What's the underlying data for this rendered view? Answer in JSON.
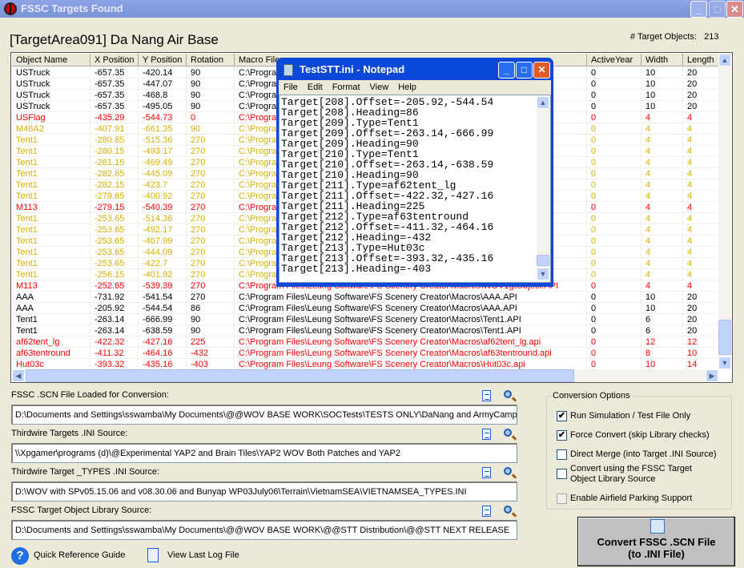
{
  "window": {
    "title": "FSSC Targets Found",
    "min": "_",
    "max": "□",
    "close": "✕"
  },
  "header": {
    "title": "[TargetArea091]   Da Nang Air Base",
    "count_label": "# Target Objects:",
    "count": "213"
  },
  "colors": {
    "normal": "#000000",
    "red": "#ff0000",
    "yellow": "#d4b000",
    "titlebar": "#7b91d8",
    "notepad_frame": "#0a48d8"
  },
  "table": {
    "columns": [
      "Object Name",
      "X Position",
      "Y Position",
      "Rotation",
      "Macro File",
      "ActiveYear",
      "Width",
      "Length"
    ],
    "rows": [
      {
        "c": "normal",
        "v": [
          "USTruck",
          "-657.35",
          "-420.14",
          "90",
          "C:\\Progra",
          "0",
          "10",
          "20"
        ]
      },
      {
        "c": "normal",
        "v": [
          "USTruck",
          "-657.35",
          "-447.07",
          "90",
          "C:\\Progra",
          "0",
          "10",
          "20"
        ]
      },
      {
        "c": "normal",
        "v": [
          "USTruck",
          "-657.35",
          "-468.8",
          "90",
          "C:\\Progra",
          "0",
          "10",
          "20"
        ]
      },
      {
        "c": "normal",
        "v": [
          "USTruck",
          "-657.35",
          "-495.05",
          "90",
          "C:\\Progra",
          "0",
          "10",
          "20"
        ]
      },
      {
        "c": "red",
        "v": [
          "USFlag",
          "-435.29",
          "-544.73",
          "0",
          "C:\\Progra",
          "0",
          "4",
          "4"
        ]
      },
      {
        "c": "yellow",
        "v": [
          "M48A2",
          "-407.91",
          "-661.35",
          "90",
          "C:\\Progra",
          "0",
          "4",
          "4"
        ]
      },
      {
        "c": "yellow",
        "v": [
          "Tent1",
          "-280.65",
          "-515.36",
          "270",
          "C:\\Progra",
          "0",
          "4",
          "4"
        ]
      },
      {
        "c": "yellow",
        "v": [
          "Tent1",
          "-280.15",
          "-493.17",
          "270",
          "C:\\Progra",
          "0",
          "4",
          "4"
        ]
      },
      {
        "c": "yellow",
        "v": [
          "Tent1",
          "-281.15",
          "-469.49",
          "270",
          "C:\\Progra",
          "0",
          "4",
          "4"
        ]
      },
      {
        "c": "yellow",
        "v": [
          "Tent1",
          "-282.65",
          "-445.09",
          "270",
          "C:\\Progra",
          "0",
          "4",
          "4"
        ]
      },
      {
        "c": "yellow",
        "v": [
          "Tent1",
          "-282.15",
          "-423.7",
          "270",
          "C:\\Progra",
          "0",
          "4",
          "4"
        ]
      },
      {
        "c": "yellow",
        "v": [
          "Tent1",
          "-279.65",
          "-400.92",
          "270",
          "C:\\Progra",
          "0",
          "4",
          "4"
        ]
      },
      {
        "c": "red",
        "v": [
          "M113",
          "-279.15",
          "-540.39",
          "270",
          "C:\\Progra",
          "0",
          "4",
          "4"
        ]
      },
      {
        "c": "yellow",
        "v": [
          "Tent1",
          "-253.65",
          "-514.36",
          "270",
          "C:\\Progra",
          "0",
          "4",
          "4"
        ]
      },
      {
        "c": "yellow",
        "v": [
          "Tent1",
          "-253.65",
          "-492.17",
          "270",
          "C:\\Progra",
          "0",
          "4",
          "4"
        ]
      },
      {
        "c": "yellow",
        "v": [
          "Tent1",
          "-253.65",
          "-467.99",
          "270",
          "C:\\Progra",
          "0",
          "4",
          "4"
        ]
      },
      {
        "c": "yellow",
        "v": [
          "Tent1",
          "-253.65",
          "-444.09",
          "270",
          "C:\\Progra",
          "0",
          "4",
          "4"
        ]
      },
      {
        "c": "yellow",
        "v": [
          "Tent1",
          "-253.65",
          "-422.7",
          "270",
          "C:\\Progra",
          "0",
          "4",
          "4"
        ]
      },
      {
        "c": "yellow",
        "v": [
          "Tent1",
          "-256.15",
          "-401.92",
          "270",
          "C:\\Progra",
          "0",
          "4",
          "4"
        ]
      },
      {
        "c": "red",
        "v": [
          "M113",
          "-252.65",
          "-539.39",
          "270",
          "C:\\Program Files\\Leung Software\\FS Scenery Creator\\Macros\\WOV1gtObject.API",
          "0",
          "4",
          "4"
        ]
      },
      {
        "c": "normal",
        "v": [
          "AAA",
          "-731.92",
          "-541.54",
          "270",
          "C:\\Program Files\\Leung Software\\FS Scenery Creator\\Macros\\AAA.API",
          "0",
          "10",
          "20"
        ]
      },
      {
        "c": "normal",
        "v": [
          "AAA",
          "-205.92",
          "-544.54",
          "86",
          "C:\\Program Files\\Leung Software\\FS Scenery Creator\\Macros\\AAA.API",
          "0",
          "10",
          "20"
        ]
      },
      {
        "c": "normal",
        "v": [
          "Tent1",
          "-263.14",
          "-666.99",
          "90",
          "C:\\Program Files\\Leung Software\\FS Scenery Creator\\Macros\\Tent1.API",
          "0",
          "6",
          "20"
        ]
      },
      {
        "c": "normal",
        "v": [
          "Tent1",
          "-263.14",
          "-638.59",
          "90",
          "C:\\Program Files\\Leung Software\\FS Scenery Creator\\Macros\\Tent1.API",
          "0",
          "6",
          "20"
        ]
      },
      {
        "c": "red",
        "v": [
          "af62tent_lg",
          "-422.32",
          "-427.16",
          "225",
          "C:\\Program Files\\Leung Software\\FS Scenery Creator\\Macros\\af62tent_lg.api",
          "0",
          "12",
          "12"
        ]
      },
      {
        "c": "red",
        "v": [
          "af63tentround",
          "-411.32",
          "-464.16",
          "-432",
          "C:\\Program Files\\Leung Software\\FS Scenery Creator\\Macros\\af63tentround.api",
          "0",
          "8",
          "10"
        ]
      },
      {
        "c": "red",
        "v": [
          "Hut03c",
          "-393.32",
          "-435.16",
          "-403",
          "C:\\Program Files\\Leung Software\\FS Scenery Creator\\Macros\\Hut03c.api",
          "0",
          "10",
          "14"
        ]
      }
    ]
  },
  "notepad": {
    "title": "TestSTT.ini - Notepad",
    "menu": [
      "File",
      "Edit",
      "Format",
      "View",
      "Help"
    ],
    "lines": [
      "Target[208].Offset=-205.92,-544.54",
      "Target[208].Heading=86",
      "Target[209].Type=Tent1",
      "Target[209].Offset=-263.14,-666.99",
      "Target[209].Heading=90",
      "Target[210].Type=Tent1",
      "Target[210].Offset=-263.14,-638.59",
      "Target[210].Heading=90",
      "Target[211].Type=af62tent_lg",
      "Target[211].Offset=-422.32,-427.16",
      "Target[211].Heading=225",
      "Target[212].Type=af63tentround",
      "Target[212].Offset=-411.32,-464.16",
      "Target[212].Heading=-432",
      "Target[213].Type=Hut03c",
      "Target[213].Offset=-393.32,-435.16",
      "Target[213].Heading=-403"
    ]
  },
  "fields": [
    {
      "label": "FSSC .SCN File Loaded for Conversion:",
      "value": "D:\\Documents and Settings\\sswamba\\My Documents\\@@WOV BASE WORK\\SOCTests\\TESTS ONLY\\DaNang and ArmyCamp"
    },
    {
      "label": "Thirdwire Targets .INI Source:",
      "value": "\\\\Xpgamer\\programs (d)\\@Experimental YAP2 and Brain Tiles\\YAP2 WOV Both Patches and YAP2"
    },
    {
      "label": "Thirdwire Target _TYPES .INI Source:",
      "value": "D:\\WOV with SPv05.15.06 and  v08.30.06 and Bunyap WP03July06\\Terrain\\VietnamSEA\\VIETNAMSEA_TYPES.INI"
    },
    {
      "label": "FSSC Target Object Library Source:",
      "value": "D:\\Documents and Settings\\sswamba\\My Documents\\@@WOV BASE WORK\\@@STT Distribution\\@@STT NEXT RELEASE"
    }
  ],
  "options": {
    "title": "Conversion Options",
    "items": [
      {
        "label": "Run Simulation / Test File Only",
        "checked": true
      },
      {
        "label": "Force Convert (skip Library checks)",
        "checked": true
      },
      {
        "label": "Direct Merge (into Target .INI Source)",
        "checked": false
      },
      {
        "label": "Convert using the FSSC Target\nObject Library Source",
        "checked": false
      },
      {
        "label": "Enable Airfield Parking Support",
        "checked": false,
        "disabled": true
      }
    ]
  },
  "convert": {
    "line1": "Convert FSSC .SCN File",
    "line2": "(to .INI File)"
  },
  "links": {
    "help": "Quick Reference Guide",
    "log": "View Last Log File"
  }
}
